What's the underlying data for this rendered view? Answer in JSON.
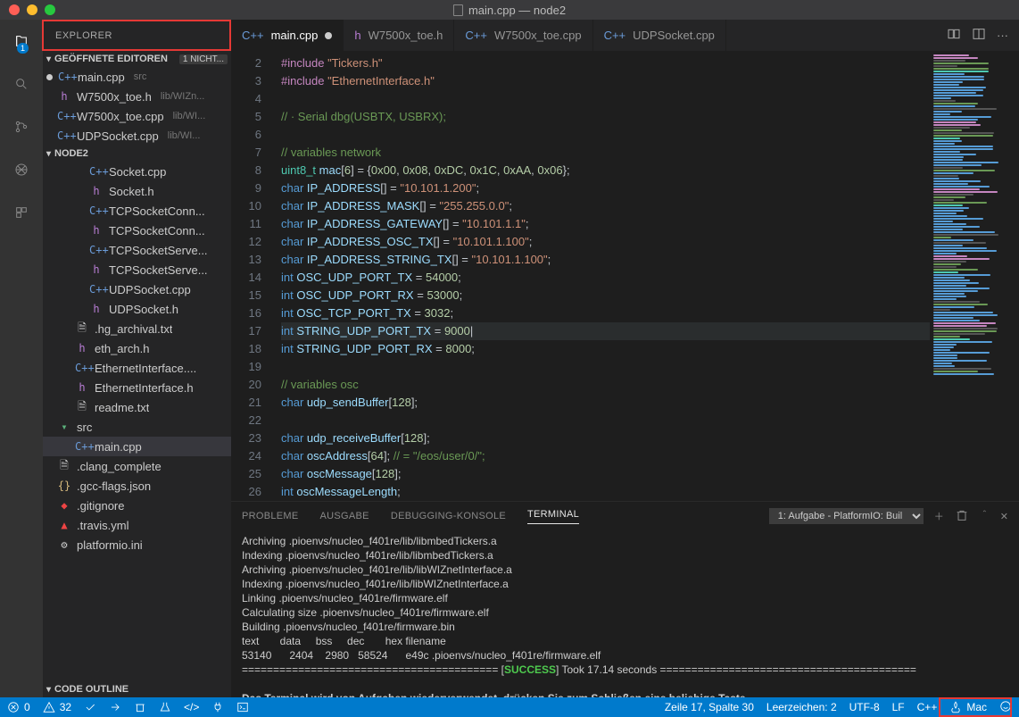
{
  "window": {
    "title": "main.cpp — node2"
  },
  "explorer": {
    "title": "EXPLORER",
    "openEditors": {
      "label": "GEÖFFNETE EDITOREN",
      "badge": "1 NICHT..."
    },
    "editors": [
      {
        "icon": "C++",
        "name": "main.cpp",
        "detail": "src",
        "modified": true
      },
      {
        "icon": "h",
        "name": "W7500x_toe.h",
        "detail": "lib/WIZn..."
      },
      {
        "icon": "C++",
        "name": "W7500x_toe.cpp",
        "detail": "lib/WI..."
      },
      {
        "icon": "C++",
        "name": "UDPSocket.cpp",
        "detail": "lib/WI..."
      }
    ],
    "root": "NODE2",
    "files": [
      {
        "l": 3,
        "ic": "cpp",
        "nm": "Socket.cpp"
      },
      {
        "l": 3,
        "ic": "hdr",
        "nm": "Socket.h"
      },
      {
        "l": 3,
        "ic": "cpp",
        "nm": "TCPSocketConn..."
      },
      {
        "l": 3,
        "ic": "hdr",
        "nm": "TCPSocketConn..."
      },
      {
        "l": 3,
        "ic": "cpp",
        "nm": "TCPSocketServe..."
      },
      {
        "l": 3,
        "ic": "hdr",
        "nm": "TCPSocketServe..."
      },
      {
        "l": 3,
        "ic": "cpp",
        "nm": "UDPSocket.cpp"
      },
      {
        "l": 3,
        "ic": "hdr",
        "nm": "UDPSocket.h"
      },
      {
        "l": 2,
        "ic": "doc",
        "nm": ".hg_archival.txt"
      },
      {
        "l": 2,
        "ic": "hdr",
        "nm": "eth_arch.h"
      },
      {
        "l": 2,
        "ic": "cpp",
        "nm": "EthernetInterface...."
      },
      {
        "l": 2,
        "ic": "hdr",
        "nm": "EthernetInterface.h"
      },
      {
        "l": 2,
        "ic": "doc",
        "nm": "readme.txt"
      },
      {
        "l": 1,
        "ic": "fld",
        "nm": "src",
        "folder": true,
        "open": true
      },
      {
        "l": 2,
        "ic": "cpp",
        "nm": "main.cpp",
        "sel": true
      },
      {
        "l": 1,
        "ic": "doc",
        "nm": ".clang_complete"
      },
      {
        "l": 1,
        "ic": "json",
        "nm": ".gcc-flags.json"
      },
      {
        "l": 1,
        "ic": "git",
        "nm": ".gitignore"
      },
      {
        "l": 1,
        "ic": "yml",
        "nm": ".travis.yml"
      },
      {
        "l": 1,
        "ic": "ini",
        "nm": "platformio.ini"
      }
    ],
    "outline": "CODE OUTLINE"
  },
  "tabs": [
    {
      "ic": "C++",
      "label": "main.cpp",
      "active": true,
      "mod": true
    },
    {
      "ic": "h",
      "label": "W7500x_toe.h"
    },
    {
      "ic": "C++",
      "label": "W7500x_toe.cpp"
    },
    {
      "ic": "C++",
      "label": "UDPSocket.cpp"
    }
  ],
  "code": {
    "start": 2,
    "highlight": 17,
    "lines": [
      [
        [
          "pp",
          "#include"
        ],
        [
          "p",
          " "
        ],
        [
          "s",
          "\"Tickers.h\""
        ]
      ],
      [
        [
          "pp",
          "#include"
        ],
        [
          "p",
          " "
        ],
        [
          "s",
          "\"EthernetInterface.h\""
        ]
      ],
      [],
      [
        [
          "c",
          "// · Serial dbg(USBTX, USBRX);"
        ]
      ],
      [],
      [
        [
          "c",
          "// variables network"
        ]
      ],
      [
        [
          "ty",
          "uint8_t"
        ],
        [
          "p",
          " "
        ],
        [
          "id",
          "mac"
        ],
        [
          "p",
          "["
        ],
        [
          "n",
          "6"
        ],
        [
          "p",
          "] = {"
        ],
        [
          "n",
          "0x00"
        ],
        [
          "p",
          ", "
        ],
        [
          "n",
          "0x08"
        ],
        [
          "p",
          ", "
        ],
        [
          "n",
          "0xDC"
        ],
        [
          "p",
          ", "
        ],
        [
          "n",
          "0x1C"
        ],
        [
          "p",
          ", "
        ],
        [
          "n",
          "0xAA"
        ],
        [
          "p",
          ", "
        ],
        [
          "n",
          "0x06"
        ],
        [
          "p",
          "};"
        ]
      ],
      [
        [
          "kw",
          "char"
        ],
        [
          "p",
          " "
        ],
        [
          "id",
          "IP_ADDRESS"
        ],
        [
          "p",
          "[] = "
        ],
        [
          "s",
          "\"10.101.1.200\""
        ],
        [
          "p",
          ";"
        ]
      ],
      [
        [
          "kw",
          "char"
        ],
        [
          "p",
          " "
        ],
        [
          "id",
          "IP_ADDRESS_MASK"
        ],
        [
          "p",
          "[] = "
        ],
        [
          "s",
          "\"255.255.0.0\""
        ],
        [
          "p",
          ";"
        ]
      ],
      [
        [
          "kw",
          "char"
        ],
        [
          "p",
          " "
        ],
        [
          "id",
          "IP_ADDRESS_GATEWAY"
        ],
        [
          "p",
          "[] = "
        ],
        [
          "s",
          "\"10.101.1.1\""
        ],
        [
          "p",
          ";"
        ]
      ],
      [
        [
          "kw",
          "char"
        ],
        [
          "p",
          " "
        ],
        [
          "id",
          "IP_ADDRESS_OSC_TX"
        ],
        [
          "p",
          "[] = "
        ],
        [
          "s",
          "\"10.101.1.100\""
        ],
        [
          "p",
          ";"
        ]
      ],
      [
        [
          "kw",
          "char"
        ],
        [
          "p",
          " "
        ],
        [
          "id",
          "IP_ADDRESS_STRING_TX"
        ],
        [
          "p",
          "[] = "
        ],
        [
          "s",
          "\"10.101.1.100\""
        ],
        [
          "p",
          ";"
        ]
      ],
      [
        [
          "kw",
          "int"
        ],
        [
          "p",
          " "
        ],
        [
          "id",
          "OSC_UDP_PORT_TX"
        ],
        [
          "p",
          " = "
        ],
        [
          "n",
          "54000"
        ],
        [
          "p",
          ";"
        ]
      ],
      [
        [
          "kw",
          "int"
        ],
        [
          "p",
          " "
        ],
        [
          "id",
          "OSC_UDP_PORT_RX"
        ],
        [
          "p",
          " = "
        ],
        [
          "n",
          "53000"
        ],
        [
          "p",
          ";"
        ]
      ],
      [
        [
          "kw",
          "int"
        ],
        [
          "p",
          " "
        ],
        [
          "id",
          "OSC_TCP_PORT_TX"
        ],
        [
          "p",
          " = "
        ],
        [
          "n",
          "3032"
        ],
        [
          "p",
          ";"
        ]
      ],
      [
        [
          "kw",
          "int"
        ],
        [
          "p",
          " "
        ],
        [
          "id",
          "STRING_UDP_PORT_TX"
        ],
        [
          "p",
          " = "
        ],
        [
          "n",
          "9000"
        ],
        [
          "p",
          "|"
        ]
      ],
      [
        [
          "kw",
          "int"
        ],
        [
          "p",
          " "
        ],
        [
          "id",
          "STRING_UDP_PORT_RX"
        ],
        [
          "p",
          " = "
        ],
        [
          "n",
          "8000"
        ],
        [
          "p",
          ";"
        ]
      ],
      [],
      [
        [
          "c",
          "// variables osc"
        ]
      ],
      [
        [
          "kw",
          "char"
        ],
        [
          "p",
          " "
        ],
        [
          "id",
          "udp_sendBuffer"
        ],
        [
          "p",
          "["
        ],
        [
          "n",
          "128"
        ],
        [
          "p",
          "];"
        ]
      ],
      [],
      [
        [
          "kw",
          "char"
        ],
        [
          "p",
          " "
        ],
        [
          "id",
          "udp_receiveBuffer"
        ],
        [
          "p",
          "["
        ],
        [
          "n",
          "128"
        ],
        [
          "p",
          "];"
        ]
      ],
      [
        [
          "kw",
          "char"
        ],
        [
          "p",
          " "
        ],
        [
          "id",
          "oscAddress"
        ],
        [
          "p",
          "["
        ],
        [
          "n",
          "64"
        ],
        [
          "p",
          "]; "
        ],
        [
          "c",
          "// = \"/eos/user/0/\";"
        ]
      ],
      [
        [
          "kw",
          "char"
        ],
        [
          "p",
          " "
        ],
        [
          "id",
          "oscMessage"
        ],
        [
          "p",
          "["
        ],
        [
          "n",
          "128"
        ],
        [
          "p",
          "];"
        ]
      ],
      [
        [
          "kw",
          "int"
        ],
        [
          "p",
          " "
        ],
        [
          "id",
          "oscMessageLength"
        ],
        [
          "p",
          ";"
        ]
      ]
    ]
  },
  "panel": {
    "tabs": [
      "PROBLEME",
      "AUSGABE",
      "DEBUGGING-KONSOLE",
      "TERMINAL"
    ],
    "active": 3,
    "dropdown": "1: Aufgabe - PlatformIO: Buil",
    "term": [
      "Archiving .pioenvs/nucleo_f401re/lib/libmbedTickers.a",
      "Indexing .pioenvs/nucleo_f401re/lib/libmbedTickers.a",
      "Archiving .pioenvs/nucleo_f401re/lib/libWIZnetInterface.a",
      "Indexing .pioenvs/nucleo_f401re/lib/libWIZnetInterface.a",
      "Linking .pioenvs/nucleo_f401re/firmware.elf",
      "Calculating size .pioenvs/nucleo_f401re/firmware.elf",
      "Building .pioenvs/nucleo_f401re/firmware.bin",
      "text       data     bss     dec       hex filename",
      "53140      2404    2980   58524      e49c .pioenvs/nucleo_f401re/firmware.elf"
    ],
    "success_pre": "========================================= [",
    "success": "SUCCESS",
    "success_post": "] Took 17.14 seconds =========================================",
    "footer": "Das Terminal wird von Aufgaben wiederverwendet, drücken Sie zum Schließen eine beliebige Taste."
  },
  "status": {
    "errors": "0",
    "warnings": "32",
    "cursor": "Zeile 17, Spalte 30",
    "spaces": "Leerzeichen: 2",
    "encoding": "UTF-8",
    "eol": "LF",
    "lang": "C++",
    "target": "Mac"
  },
  "actbadge": "1"
}
